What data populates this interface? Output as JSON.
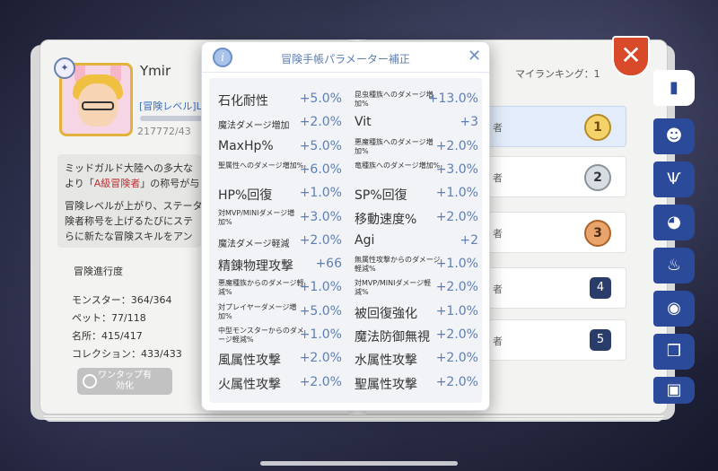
{
  "player": {
    "name": "Ymir",
    "adventure_level_label": "[冒険レベル]L",
    "exp_text": "217772/43"
  },
  "description": {
    "line1": "ミッドガルド大陸への多大な",
    "line2_pre": "より「",
    "line2_highlight": "A級冒険者",
    "line2_post": "」の称号が与",
    "line3": "冒険レベルが上がり、ステータ",
    "line4": "険者称号を上げるたびにステ",
    "line5": "らに新たな冒険スキルをアン"
  },
  "progress": {
    "title": "冒険進行度",
    "stats": [
      {
        "label": "モンスター",
        "value": "364/364"
      },
      {
        "label": "ペット",
        "value": "77/118"
      },
      {
        "label": "名所",
        "value": "415/417"
      },
      {
        "label": "コレクション",
        "value": "433/433"
      }
    ]
  },
  "auto_button": {
    "line1": "ワンタップ有",
    "line2": "効化"
  },
  "ranking": {
    "my_rank_label": "マイランキング：1",
    "rows": [
      {
        "suffix": "者",
        "rank": "1"
      },
      {
        "suffix": "者",
        "rank": "2"
      },
      {
        "suffix": "者",
        "rank": "3"
      },
      {
        "suffix": "者",
        "rank": "4"
      },
      {
        "suffix": "者",
        "rank": "5"
      }
    ]
  },
  "close_button": {
    "icon": "close-icon",
    "glyph": "✕"
  },
  "tabs": [
    {
      "icon": "book-icon",
      "glyph": "▮"
    },
    {
      "icon": "monster-face-icon",
      "glyph": "☻"
    },
    {
      "icon": "claw-icon",
      "glyph": "Ѱ"
    },
    {
      "icon": "pet-icon",
      "glyph": "◕"
    },
    {
      "icon": "chef-hat-icon",
      "glyph": "♨"
    },
    {
      "icon": "landmark-icon",
      "glyph": "◉"
    },
    {
      "icon": "open-book-icon",
      "glyph": "❒"
    },
    {
      "icon": "collection-icon",
      "glyph": "▣"
    }
  ],
  "modal": {
    "title": "冒険手帳パラメーター補正",
    "info_glyph": "i",
    "close_glyph": "✕",
    "rows": [
      {
        "l_label": "石化耐性",
        "l_size": "big",
        "l_value": "+5.0%",
        "r_label": "昆虫種族へのダメージ増加%",
        "r_size": "small",
        "r_value": "+13.0%"
      },
      {
        "l_label": "魔法ダメージ増加",
        "l_size": "medium",
        "l_value": "+2.0%",
        "r_label": "Vit",
        "r_size": "big",
        "r_value": "+3"
      },
      {
        "l_label": "MaxHp%",
        "l_size": "big",
        "l_value": "+5.0%",
        "r_label": "悪魔種族へのダメージ増加%",
        "r_size": "small",
        "r_value": "+2.0%"
      },
      {
        "l_label": "聖属性へのダメージ増加%",
        "l_size": "small",
        "l_value": "+6.0%",
        "r_label": "竜種族へのダメージ増加%",
        "r_size": "small",
        "r_value": "+3.0%"
      },
      {
        "l_label": "HP%回復",
        "l_size": "big",
        "l_value": "+1.0%",
        "r_label": "SP%回復",
        "r_size": "big",
        "r_value": "+1.0%"
      },
      {
        "l_label": "対MVP/MINIダメージ増加%",
        "l_size": "small",
        "l_value": "+3.0%",
        "r_label": "移動速度%",
        "r_size": "big",
        "r_value": "+2.0%"
      },
      {
        "l_label": "魔法ダメージ軽減",
        "l_size": "medium",
        "l_value": "+2.0%",
        "r_label": "Agi",
        "r_size": "big",
        "r_value": "+2"
      },
      {
        "l_label": "精錬物理攻撃",
        "l_size": "big",
        "l_value": "+66",
        "r_label": "無属性攻撃からのダメージ軽減%",
        "r_size": "small",
        "r_value": "+1.0%"
      },
      {
        "l_label": "悪魔種族からのダメージ軽減%",
        "l_size": "small",
        "l_value": "+1.0%",
        "r_label": "対MVP/MINIダメージ軽減%",
        "r_size": "small",
        "r_value": "+2.0%"
      },
      {
        "l_label": "対プレイヤーダメージ増加%",
        "l_size": "small",
        "l_value": "+5.0%",
        "r_label": "被回復強化",
        "r_size": "big",
        "r_value": "+1.0%"
      },
      {
        "l_label": "中型モンスターからのダメージ軽減%",
        "l_size": "small",
        "l_value": "+1.0%",
        "r_label": "魔法防御無視",
        "r_size": "big",
        "r_value": "+2.0%"
      },
      {
        "l_label": "風属性攻撃",
        "l_size": "big",
        "l_value": "+2.0%",
        "r_label": "水属性攻撃",
        "r_size": "big",
        "r_value": "+2.0%"
      },
      {
        "l_label": "火属性攻撃",
        "l_size": "big",
        "l_value": "+2.0%",
        "r_label": "聖属性攻撃",
        "r_size": "big",
        "r_value": "+2.0%"
      }
    ]
  }
}
